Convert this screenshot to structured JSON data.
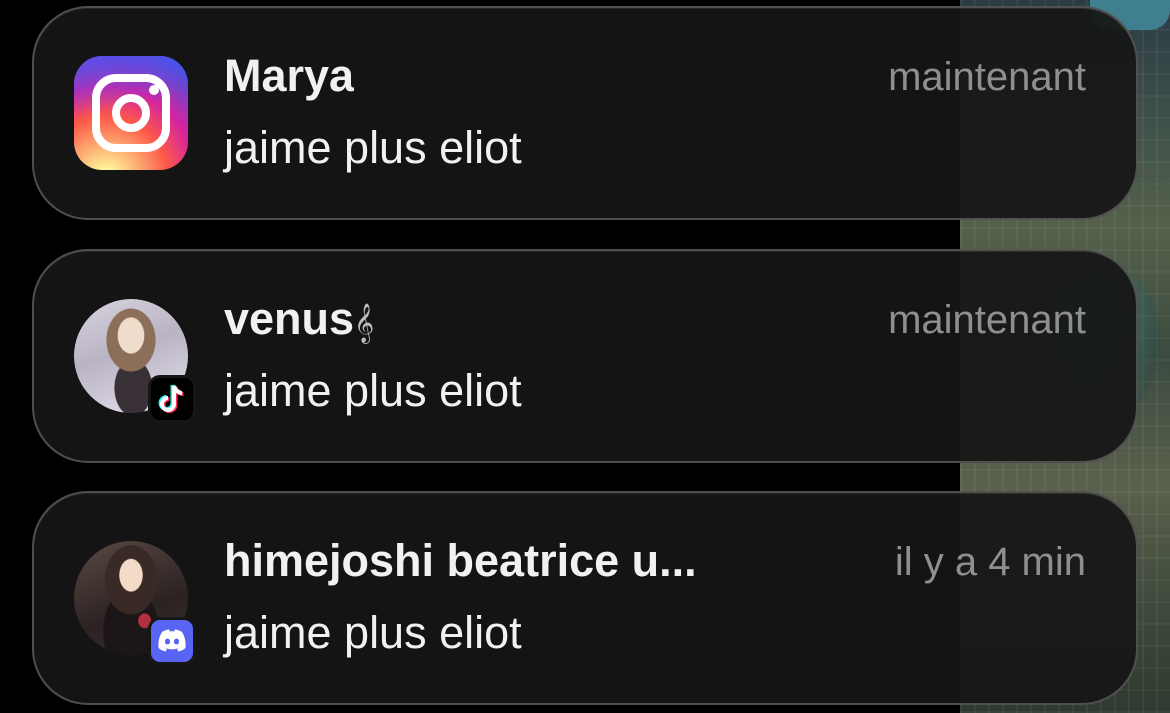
{
  "notifications": [
    {
      "app": "Instagram",
      "app_icon": "instagram-icon",
      "title": "Marya",
      "body": "jaime plus eliot",
      "time": "maintenant"
    },
    {
      "app": "TikTok",
      "app_icon": "tiktok-icon",
      "title": "venus",
      "title_suffix": "𝄞",
      "body": "jaime plus eliot",
      "time": "maintenant"
    },
    {
      "app": "Discord",
      "app_icon": "discord-icon",
      "title": "himejoshi beatrice u...",
      "body": "jaime plus eliot",
      "time": "il y a 4 min"
    }
  ],
  "colors": {
    "card_background": "#161616",
    "title_text": "#f1f1f1",
    "time_text": "#8f8f8f",
    "discord_brand": "#5865F2"
  }
}
